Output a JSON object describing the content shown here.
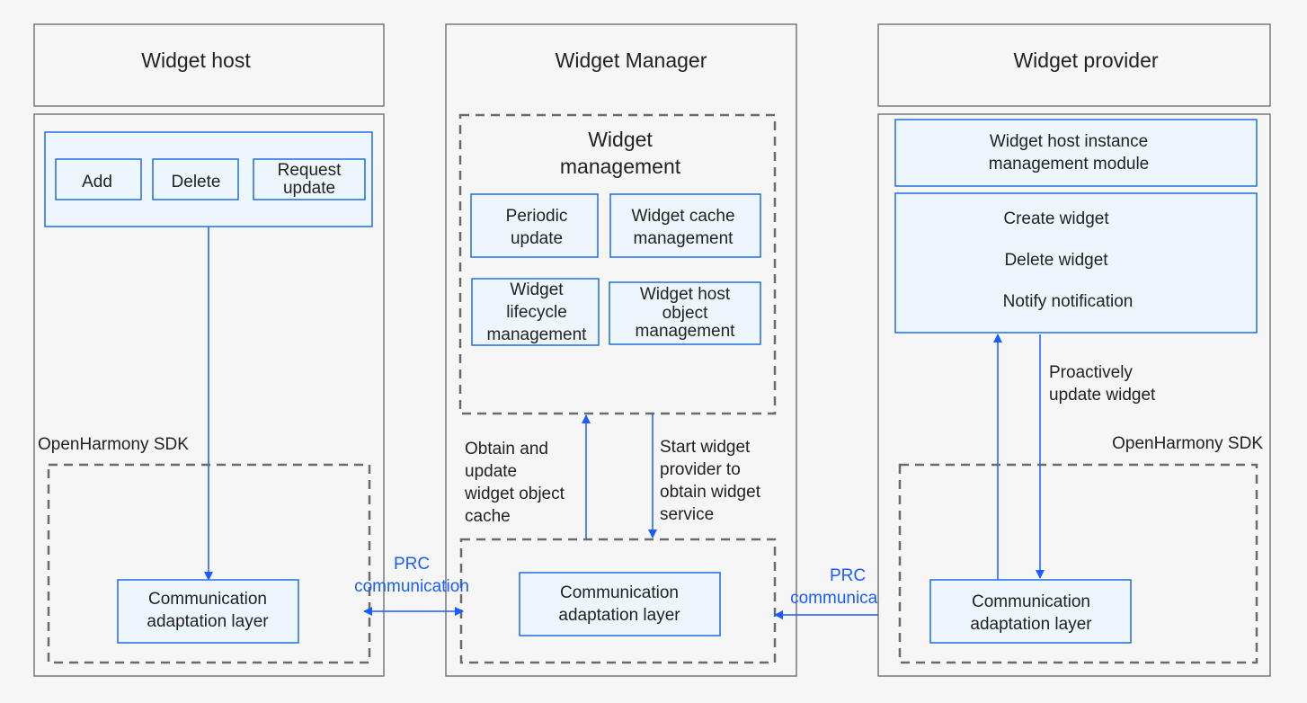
{
  "colors": {
    "accent": "#1a5cff",
    "box_border": "#1e6fe0",
    "box_fill": "#eef6fd",
    "background": "#f6f6f6"
  },
  "host": {
    "title": "Widget host",
    "buttons": [
      "Add",
      "Delete"
    ],
    "request_update": [
      "Request",
      "update"
    ],
    "sdk_label": "OpenHarmony SDK",
    "comm": [
      "Communication",
      "adaptation layer"
    ]
  },
  "manager": {
    "title": "Widget Manager",
    "management": [
      "Widget",
      "management"
    ],
    "periodic": [
      "Periodic",
      "update"
    ],
    "cache": [
      "Widget cache",
      "management"
    ],
    "lifecycle": [
      "Widget",
      "lifecycle",
      "management"
    ],
    "hostobj": [
      "Widget host",
      "object",
      "management"
    ],
    "obtain": [
      "Obtain and",
      "update",
      "widget object",
      "cache"
    ],
    "start": [
      "Start widget",
      "provider to",
      "obtain widget",
      "service"
    ],
    "comm": [
      "Communication",
      "adaptation layer"
    ]
  },
  "rpc1": [
    "PRC",
    "communication"
  ],
  "rpc2": [
    "PRC",
    "communication"
  ],
  "provider": {
    "title": "Widget provider",
    "instance": [
      "Widget host instance",
      "management module"
    ],
    "actions": [
      "Create widget",
      "Delete widget",
      "Notify notification"
    ],
    "proactive": [
      "Proactively",
      "update widget"
    ],
    "sdk_label": "OpenHarmony SDK",
    "comm": [
      "Communication",
      "adaptation layer"
    ]
  }
}
